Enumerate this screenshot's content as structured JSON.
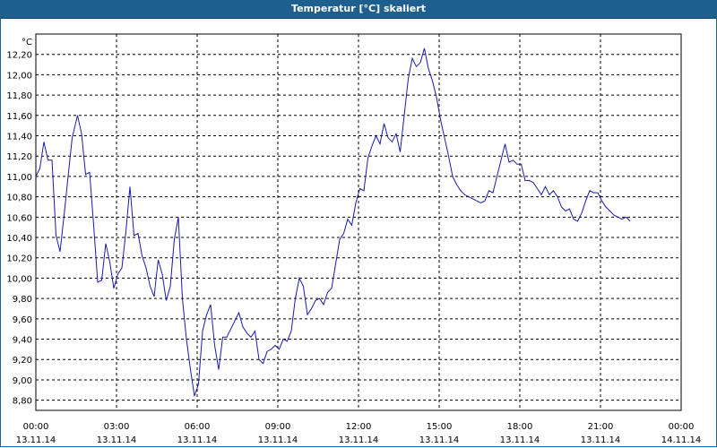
{
  "window": {
    "title": "Temperatur [°C] skaliert"
  },
  "colors": {
    "title_bg": "#1f5f8f",
    "line": "#1a1aa6",
    "grid": "#000000"
  },
  "chart_data": {
    "type": "line",
    "title": "Temperatur [°C] skaliert",
    "yunit": "°C",
    "ylim": [
      8.7,
      12.4
    ],
    "yticks": [
      {
        "v": 12.2,
        "label": "12,20"
      },
      {
        "v": 12.0,
        "label": "12,00"
      },
      {
        "v": 11.8,
        "label": "11,80"
      },
      {
        "v": 11.6,
        "label": "11,60"
      },
      {
        "v": 11.4,
        "label": "11,40"
      },
      {
        "v": 11.2,
        "label": "11,20"
      },
      {
        "v": 11.0,
        "label": "11,00"
      },
      {
        "v": 10.8,
        "label": "10,80"
      },
      {
        "v": 10.6,
        "label": "10,60"
      },
      {
        "v": 10.4,
        "label": "10,40"
      },
      {
        "v": 10.2,
        "label": "10,20"
      },
      {
        "v": 10.0,
        "label": "10,00"
      },
      {
        "v": 9.8,
        "label": "9,80"
      },
      {
        "v": 9.6,
        "label": "9,60"
      },
      {
        "v": 9.4,
        "label": "9,40"
      },
      {
        "v": 9.2,
        "label": "9,20"
      },
      {
        "v": 9.0,
        "label": "9,00"
      },
      {
        "v": 8.8,
        "label": "8,80"
      }
    ],
    "xticks": [
      {
        "h": 0,
        "time": "00:00",
        "date": "13.11.14"
      },
      {
        "h": 3,
        "time": "03:00",
        "date": "13.11.14"
      },
      {
        "h": 6,
        "time": "06:00",
        "date": "13.11.14"
      },
      {
        "h": 9,
        "time": "09:00",
        "date": "13.11.14"
      },
      {
        "h": 12,
        "time": "12:00",
        "date": "13.11.14"
      },
      {
        "h": 15,
        "time": "15:00",
        "date": "13.11.14"
      },
      {
        "h": 18,
        "time": "18:00",
        "date": "13.11.14"
      },
      {
        "h": 21,
        "time": "21:00",
        "date": "13.11.14"
      },
      {
        "h": 24,
        "time": "00:00",
        "date": "14.11.14"
      }
    ],
    "grid": true,
    "series": [
      {
        "points": [
          [
            0,
            11.0
          ],
          [
            0.15,
            11.08
          ],
          [
            0.3,
            11.34
          ],
          [
            0.45,
            11.16
          ],
          [
            0.6,
            11.16
          ],
          [
            0.75,
            10.42
          ],
          [
            0.9,
            10.26
          ],
          [
            1.05,
            10.62
          ],
          [
            1.2,
            11.0
          ],
          [
            1.35,
            11.38
          ],
          [
            1.55,
            11.6
          ],
          [
            1.7,
            11.42
          ],
          [
            1.85,
            11.02
          ],
          [
            2.0,
            11.04
          ],
          [
            2.15,
            10.52
          ],
          [
            2.3,
            9.96
          ],
          [
            2.45,
            9.98
          ],
          [
            2.6,
            10.34
          ],
          [
            2.75,
            10.16
          ],
          [
            2.9,
            9.9
          ],
          [
            3.05,
            10.04
          ],
          [
            3.2,
            10.1
          ],
          [
            3.35,
            10.46
          ],
          [
            3.5,
            10.9
          ],
          [
            3.65,
            10.42
          ],
          [
            3.8,
            10.44
          ],
          [
            3.95,
            10.22
          ],
          [
            4.1,
            10.1
          ],
          [
            4.25,
            9.92
          ],
          [
            4.4,
            9.82
          ],
          [
            4.55,
            10.18
          ],
          [
            4.7,
            10.04
          ],
          [
            4.85,
            9.78
          ],
          [
            5.0,
            9.92
          ],
          [
            5.15,
            10.38
          ],
          [
            5.3,
            10.6
          ],
          [
            5.45,
            9.8
          ],
          [
            5.6,
            9.4
          ],
          [
            5.75,
            9.1
          ],
          [
            5.9,
            8.84
          ],
          [
            6.05,
            8.96
          ],
          [
            6.2,
            9.48
          ],
          [
            6.35,
            9.64
          ],
          [
            6.5,
            9.74
          ],
          [
            6.65,
            9.34
          ],
          [
            6.8,
            9.1
          ],
          [
            6.95,
            9.42
          ],
          [
            7.1,
            9.42
          ],
          [
            7.25,
            9.5
          ],
          [
            7.4,
            9.58
          ],
          [
            7.55,
            9.66
          ],
          [
            7.7,
            9.52
          ],
          [
            7.85,
            9.46
          ],
          [
            8.0,
            9.42
          ],
          [
            8.15,
            9.48
          ],
          [
            8.3,
            9.2
          ],
          [
            8.45,
            9.16
          ],
          [
            8.6,
            9.28
          ],
          [
            8.75,
            9.3
          ],
          [
            8.9,
            9.34
          ],
          [
            9.05,
            9.3
          ],
          [
            9.2,
            9.4
          ],
          [
            9.35,
            9.38
          ],
          [
            9.5,
            9.48
          ],
          [
            9.65,
            9.8
          ],
          [
            9.8,
            10.0
          ],
          [
            9.95,
            9.92
          ],
          [
            10.1,
            9.64
          ],
          [
            10.25,
            9.7
          ],
          [
            10.4,
            9.78
          ],
          [
            10.55,
            9.8
          ],
          [
            10.7,
            9.74
          ],
          [
            10.85,
            9.86
          ],
          [
            11.0,
            9.9
          ],
          [
            11.15,
            10.14
          ],
          [
            11.3,
            10.38
          ],
          [
            11.45,
            10.44
          ],
          [
            11.6,
            10.58
          ],
          [
            11.75,
            10.52
          ],
          [
            11.9,
            10.74
          ],
          [
            12.05,
            10.88
          ],
          [
            12.2,
            10.86
          ],
          [
            12.35,
            11.18
          ],
          [
            12.5,
            11.3
          ],
          [
            12.65,
            11.4
          ],
          [
            12.8,
            11.32
          ],
          [
            12.95,
            11.52
          ],
          [
            13.1,
            11.38
          ],
          [
            13.25,
            11.34
          ],
          [
            13.4,
            11.42
          ],
          [
            13.55,
            11.24
          ],
          [
            13.7,
            11.6
          ],
          [
            13.85,
            11.96
          ],
          [
            14.0,
            12.16
          ],
          [
            14.15,
            12.08
          ],
          [
            14.3,
            12.12
          ],
          [
            14.45,
            12.26
          ],
          [
            14.6,
            12.06
          ],
          [
            14.75,
            11.94
          ],
          [
            14.9,
            11.78
          ],
          [
            15.05,
            11.56
          ],
          [
            15.2,
            11.38
          ],
          [
            15.35,
            11.2
          ],
          [
            15.5,
            11.0
          ],
          [
            15.65,
            10.92
          ],
          [
            15.8,
            10.86
          ],
          [
            15.95,
            10.82
          ],
          [
            16.1,
            10.8
          ],
          [
            16.25,
            10.78
          ],
          [
            16.4,
            10.76
          ],
          [
            16.55,
            10.74
          ],
          [
            16.7,
            10.76
          ],
          [
            16.85,
            10.86
          ],
          [
            17.0,
            10.84
          ],
          [
            17.15,
            11.0
          ],
          [
            17.3,
            11.16
          ],
          [
            17.45,
            11.32
          ],
          [
            17.6,
            11.14
          ],
          [
            17.75,
            11.16
          ],
          [
            17.9,
            11.12
          ],
          [
            18.05,
            11.12
          ],
          [
            18.2,
            10.96
          ],
          [
            18.35,
            10.96
          ],
          [
            18.5,
            10.94
          ],
          [
            18.65,
            10.88
          ],
          [
            18.8,
            10.82
          ],
          [
            18.95,
            10.9
          ],
          [
            19.1,
            10.82
          ],
          [
            19.25,
            10.86
          ],
          [
            19.4,
            10.8
          ],
          [
            19.55,
            10.7
          ],
          [
            19.7,
            10.66
          ],
          [
            19.85,
            10.68
          ],
          [
            20.0,
            10.58
          ],
          [
            20.15,
            10.56
          ],
          [
            20.3,
            10.64
          ],
          [
            20.45,
            10.76
          ],
          [
            20.6,
            10.86
          ],
          [
            20.75,
            10.84
          ],
          [
            20.9,
            10.84
          ],
          [
            21.05,
            10.76
          ],
          [
            21.2,
            10.7
          ],
          [
            21.35,
            10.66
          ],
          [
            21.5,
            10.62
          ],
          [
            21.65,
            10.6
          ],
          [
            21.8,
            10.58
          ],
          [
            21.95,
            10.6
          ],
          [
            22.1,
            10.56
          ]
        ]
      }
    ]
  }
}
